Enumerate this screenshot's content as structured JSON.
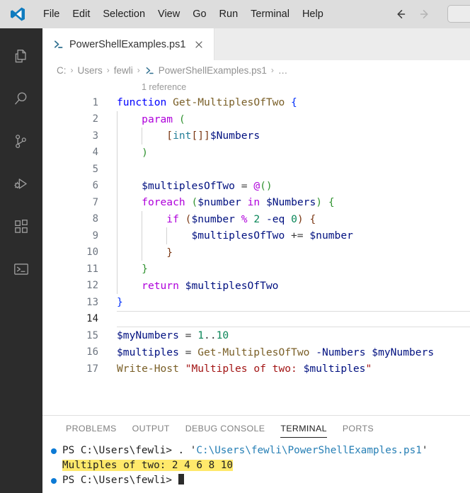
{
  "titlebar": {
    "logo_icon": "vscode-logo-icon",
    "menu": [
      {
        "label": "File"
      },
      {
        "label": "Edit"
      },
      {
        "label": "Selection"
      },
      {
        "label": "View"
      },
      {
        "label": "Go"
      },
      {
        "label": "Run"
      },
      {
        "label": "Terminal"
      },
      {
        "label": "Help"
      }
    ],
    "nav_back_icon": "arrow-left-icon",
    "nav_forward_icon": "arrow-right-icon",
    "command_center_value": ""
  },
  "activitybar": {
    "items": [
      {
        "name": "explorer",
        "icon": "files-icon"
      },
      {
        "name": "search",
        "icon": "search-icon"
      },
      {
        "name": "source-control",
        "icon": "source-control-icon"
      },
      {
        "name": "run-and-debug",
        "icon": "run-and-debug-icon"
      },
      {
        "name": "extensions",
        "icon": "extensions-icon"
      },
      {
        "name": "terminal",
        "icon": "terminal-icon"
      }
    ]
  },
  "editor": {
    "tab": {
      "icon": "powershell-icon",
      "label": "PowerShellExamples.ps1",
      "close_icon": "close-icon"
    },
    "breadcrumbs": [
      {
        "label": "C:",
        "icon": ""
      },
      {
        "label": "Users",
        "icon": ""
      },
      {
        "label": "fewli",
        "icon": ""
      },
      {
        "label": "PowerShellExamples.ps1",
        "icon": "powershell-icon"
      },
      {
        "label": "…",
        "icon": ""
      }
    ],
    "breadcrumb_separator": "›",
    "codelens": "1 reference",
    "current_line": 14,
    "lines": [
      {
        "n": 1,
        "indent": 0,
        "tokens": [
          {
            "t": "function",
            "c": "t-kw"
          },
          {
            "t": " ",
            "c": ""
          },
          {
            "t": "Get-MultiplesOfTwo",
            "c": "t-fn"
          },
          {
            "t": " ",
            "c": ""
          },
          {
            "t": "{",
            "c": "t-brk1"
          }
        ]
      },
      {
        "n": 2,
        "indent": 1,
        "tokens": [
          {
            "t": "    ",
            "c": ""
          },
          {
            "t": "param",
            "c": "t-ctl"
          },
          {
            "t": " ",
            "c": ""
          },
          {
            "t": "(",
            "c": "t-brk2"
          }
        ]
      },
      {
        "n": 3,
        "indent": 2,
        "tokens": [
          {
            "t": "        ",
            "c": ""
          },
          {
            "t": "[",
            "c": "t-brk3"
          },
          {
            "t": "int",
            "c": "t-type"
          },
          {
            "t": "[]",
            "c": "t-brk3"
          },
          {
            "t": "]",
            "c": "t-brk3"
          },
          {
            "t": "$Numbers",
            "c": "t-var"
          }
        ]
      },
      {
        "n": 4,
        "indent": 1,
        "tokens": [
          {
            "t": "    ",
            "c": ""
          },
          {
            "t": ")",
            "c": "t-brk2"
          }
        ]
      },
      {
        "n": 5,
        "indent": 1,
        "tokens": []
      },
      {
        "n": 6,
        "indent": 1,
        "tokens": [
          {
            "t": "    ",
            "c": ""
          },
          {
            "t": "$multiplesOfTwo",
            "c": "t-var"
          },
          {
            "t": " = ",
            "c": "t-punc"
          },
          {
            "t": "@",
            "c": "t-ctl"
          },
          {
            "t": "()",
            "c": "t-brk2"
          }
        ]
      },
      {
        "n": 7,
        "indent": 1,
        "tokens": [
          {
            "t": "    ",
            "c": ""
          },
          {
            "t": "foreach",
            "c": "t-ctl"
          },
          {
            "t": " ",
            "c": ""
          },
          {
            "t": "(",
            "c": "t-brk2"
          },
          {
            "t": "$number",
            "c": "t-var"
          },
          {
            "t": " ",
            "c": ""
          },
          {
            "t": "in",
            "c": "t-ctl"
          },
          {
            "t": " ",
            "c": ""
          },
          {
            "t": "$Numbers",
            "c": "t-var"
          },
          {
            "t": ")",
            "c": "t-brk2"
          },
          {
            "t": " ",
            "c": ""
          },
          {
            "t": "{",
            "c": "t-brk2"
          }
        ]
      },
      {
        "n": 8,
        "indent": 2,
        "tokens": [
          {
            "t": "        ",
            "c": ""
          },
          {
            "t": "if",
            "c": "t-ctl"
          },
          {
            "t": " ",
            "c": ""
          },
          {
            "t": "(",
            "c": "t-brk3"
          },
          {
            "t": "$number",
            "c": "t-var"
          },
          {
            "t": " ",
            "c": ""
          },
          {
            "t": "%",
            "c": "t-op"
          },
          {
            "t": " ",
            "c": ""
          },
          {
            "t": "2",
            "c": "t-num"
          },
          {
            "t": " ",
            "c": ""
          },
          {
            "t": "-eq",
            "c": "t-var"
          },
          {
            "t": " ",
            "c": ""
          },
          {
            "t": "0",
            "c": "t-num"
          },
          {
            "t": ")",
            "c": "t-brk3"
          },
          {
            "t": " ",
            "c": ""
          },
          {
            "t": "{",
            "c": "t-brk3"
          }
        ]
      },
      {
        "n": 9,
        "indent": 3,
        "tokens": [
          {
            "t": "            ",
            "c": ""
          },
          {
            "t": "$multiplesOfTwo",
            "c": "t-var"
          },
          {
            "t": " += ",
            "c": "t-punc"
          },
          {
            "t": "$number",
            "c": "t-var"
          }
        ]
      },
      {
        "n": 10,
        "indent": 2,
        "tokens": [
          {
            "t": "        ",
            "c": ""
          },
          {
            "t": "}",
            "c": "t-brk3"
          }
        ]
      },
      {
        "n": 11,
        "indent": 1,
        "tokens": [
          {
            "t": "    ",
            "c": ""
          },
          {
            "t": "}",
            "c": "t-brk2"
          }
        ]
      },
      {
        "n": 12,
        "indent": 1,
        "tokens": [
          {
            "t": "    ",
            "c": ""
          },
          {
            "t": "return",
            "c": "t-ctl"
          },
          {
            "t": " ",
            "c": ""
          },
          {
            "t": "$multiplesOfTwo",
            "c": "t-var"
          }
        ]
      },
      {
        "n": 13,
        "indent": 0,
        "tokens": [
          {
            "t": "}",
            "c": "t-brk1"
          }
        ]
      },
      {
        "n": 14,
        "indent": 0,
        "tokens": []
      },
      {
        "n": 15,
        "indent": 0,
        "tokens": [
          {
            "t": "$myNumbers",
            "c": "t-var"
          },
          {
            "t": " = ",
            "c": "t-punc"
          },
          {
            "t": "1",
            "c": "t-num"
          },
          {
            "t": "..",
            "c": "t-punc"
          },
          {
            "t": "10",
            "c": "t-num"
          }
        ]
      },
      {
        "n": 16,
        "indent": 0,
        "tokens": [
          {
            "t": "$multiples",
            "c": "t-var"
          },
          {
            "t": " = ",
            "c": "t-punc"
          },
          {
            "t": "Get-MultiplesOfTwo",
            "c": "t-fn"
          },
          {
            "t": " ",
            "c": ""
          },
          {
            "t": "-Numbers",
            "c": "t-var"
          },
          {
            "t": " ",
            "c": ""
          },
          {
            "t": "$myNumbers",
            "c": "t-var"
          }
        ]
      },
      {
        "n": 17,
        "indent": 0,
        "tokens": [
          {
            "t": "Write-Host",
            "c": "t-fn"
          },
          {
            "t": " ",
            "c": ""
          },
          {
            "t": "\"Multiples of two: ",
            "c": "t-str"
          },
          {
            "t": "$multiples",
            "c": "t-var"
          },
          {
            "t": "\"",
            "c": "t-str"
          }
        ]
      }
    ]
  },
  "panel": {
    "tabs": [
      {
        "label": "PROBLEMS",
        "active": false
      },
      {
        "label": "OUTPUT",
        "active": false
      },
      {
        "label": "DEBUG CONSOLE",
        "active": false
      },
      {
        "label": "TERMINAL",
        "active": true
      },
      {
        "label": "PORTS",
        "active": false
      }
    ],
    "terminal": {
      "lines": [
        {
          "bullet": true,
          "segments": [
            {
              "text": "PS C:\\Users\\fewli> ",
              "cls": "t-white",
              "highlight": false
            },
            {
              "text": ". '",
              "cls": "t-white",
              "highlight": false
            },
            {
              "text": "C:\\Users\\fewli\\PowerShellExamples.ps1",
              "cls": "t-path",
              "highlight": false
            },
            {
              "text": "'",
              "cls": "t-white",
              "highlight": false
            }
          ]
        },
        {
          "bullet": false,
          "segments": [
            {
              "text": "Multiples of two: 2 4 6 8 10",
              "cls": "t-white",
              "highlight": true
            }
          ]
        },
        {
          "bullet": true,
          "segments": [
            {
              "text": "PS C:\\Users\\fewli> ",
              "cls": "t-white",
              "highlight": false
            }
          ],
          "cursor": true
        }
      ]
    }
  },
  "colors": {
    "titlebar_bg": "#dddddd",
    "activitybar_bg": "#2c2c2c",
    "editor_bg": "#ffffff",
    "tabbar_bg": "#ececec",
    "accent_blue": "#0c7ad5",
    "terminal_highlight": "#ffe96b",
    "keyword": "#0000ff",
    "control": "#af00db",
    "function": "#795e26",
    "variable": "#001080",
    "string": "#a31515",
    "number": "#098658",
    "type": "#267f99"
  }
}
